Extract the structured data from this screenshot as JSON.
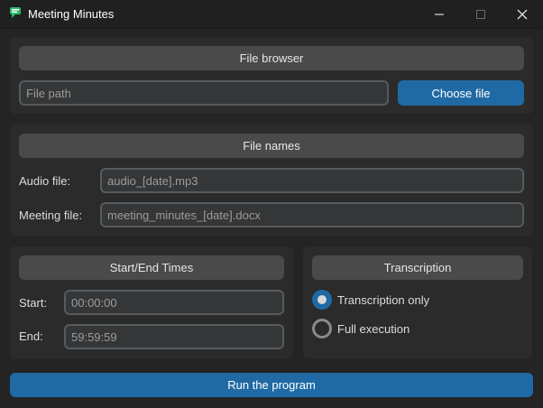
{
  "window": {
    "title": "Meeting Minutes",
    "icon": "chat-bubble-icon"
  },
  "file_browser": {
    "header": "File browser",
    "path_placeholder": "File path",
    "choose_label": "Choose file"
  },
  "file_names": {
    "header": "File names",
    "audio_label": "Audio file:",
    "audio_value": "audio_[date].mp3",
    "meeting_label": "Meeting file:",
    "meeting_value": "meeting_minutes_[date].docx"
  },
  "times": {
    "header": "Start/End Times",
    "start_label": "Start:",
    "start_value": "00:00:00",
    "end_label": "End:",
    "end_value": "59:59:59"
  },
  "transcription": {
    "header": "Transcription",
    "options": [
      {
        "label": "Transcription only",
        "selected": true
      },
      {
        "label": "Full execution",
        "selected": false
      }
    ]
  },
  "run_label": "Run the program",
  "colors": {
    "accent": "#1f6aa5",
    "background": "#242424",
    "frame": "#2b2b2b",
    "header": "#4a4a4a"
  }
}
